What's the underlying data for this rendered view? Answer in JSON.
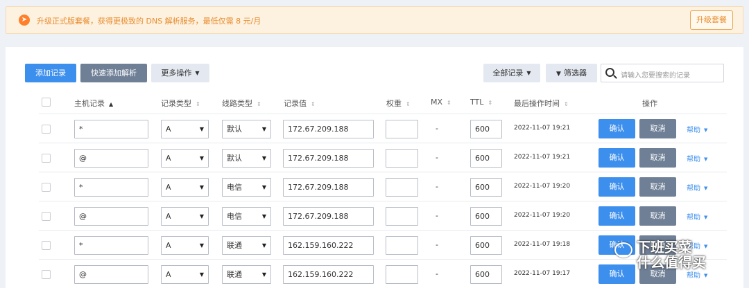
{
  "banner": {
    "text": "升级正式版套餐，获得更极致的 DNS 解析服务，最低仅需 8 元/月",
    "upgrade_label": "升级套餐",
    "icon": "rocket-icon"
  },
  "toolbar": {
    "add_record": "添加记录",
    "quick_add": "快速添加解析",
    "more_ops": "更多操作",
    "all_records": "全部记录",
    "filter": "筛选器",
    "search_placeholder": "请输入您要搜索的记录"
  },
  "columns": {
    "host": "主机记录",
    "type": "记录类型",
    "line": "线路类型",
    "value": "记录值",
    "weight": "权重",
    "mx": "MX",
    "ttl": "TTL",
    "last_op": "最后操作时间",
    "actions": "操作"
  },
  "rows": [
    {
      "host": "*",
      "type": "A",
      "line": "默认",
      "value": "172.67.209.188",
      "weight": "",
      "mx": "-",
      "ttl": "600",
      "time": "2022-11-07 19:21"
    },
    {
      "host": "@",
      "type": "A",
      "line": "默认",
      "value": "172.67.209.188",
      "weight": "",
      "mx": "-",
      "ttl": "600",
      "time": "2022-11-07 19:21"
    },
    {
      "host": "*",
      "type": "A",
      "line": "电信",
      "value": "172.67.209.188",
      "weight": "",
      "mx": "-",
      "ttl": "600",
      "time": "2022-11-07 19:20"
    },
    {
      "host": "@",
      "type": "A",
      "line": "电信",
      "value": "172.67.209.188",
      "weight": "",
      "mx": "-",
      "ttl": "600",
      "time": "2022-11-07 19:20"
    },
    {
      "host": "*",
      "type": "A",
      "line": "联通",
      "value": "162.159.160.222",
      "weight": "",
      "mx": "-",
      "ttl": "600",
      "time": "2022-11-07 19:18"
    },
    {
      "host": "@",
      "type": "A",
      "line": "联通",
      "value": "162.159.160.222",
      "weight": "",
      "mx": "-",
      "ttl": "600",
      "time": "2022-11-07 19:17"
    }
  ],
  "row_actions": {
    "confirm": "确认",
    "cancel": "取消",
    "help": "帮助"
  },
  "watermark": {
    "line1": "下班买菜",
    "line2": "什么值得买"
  },
  "colors": {
    "primary": "#3d8fed",
    "secondary": "#6f7f96",
    "banner_bg": "#fdf1e0",
    "banner_text": "#e88d2d"
  }
}
